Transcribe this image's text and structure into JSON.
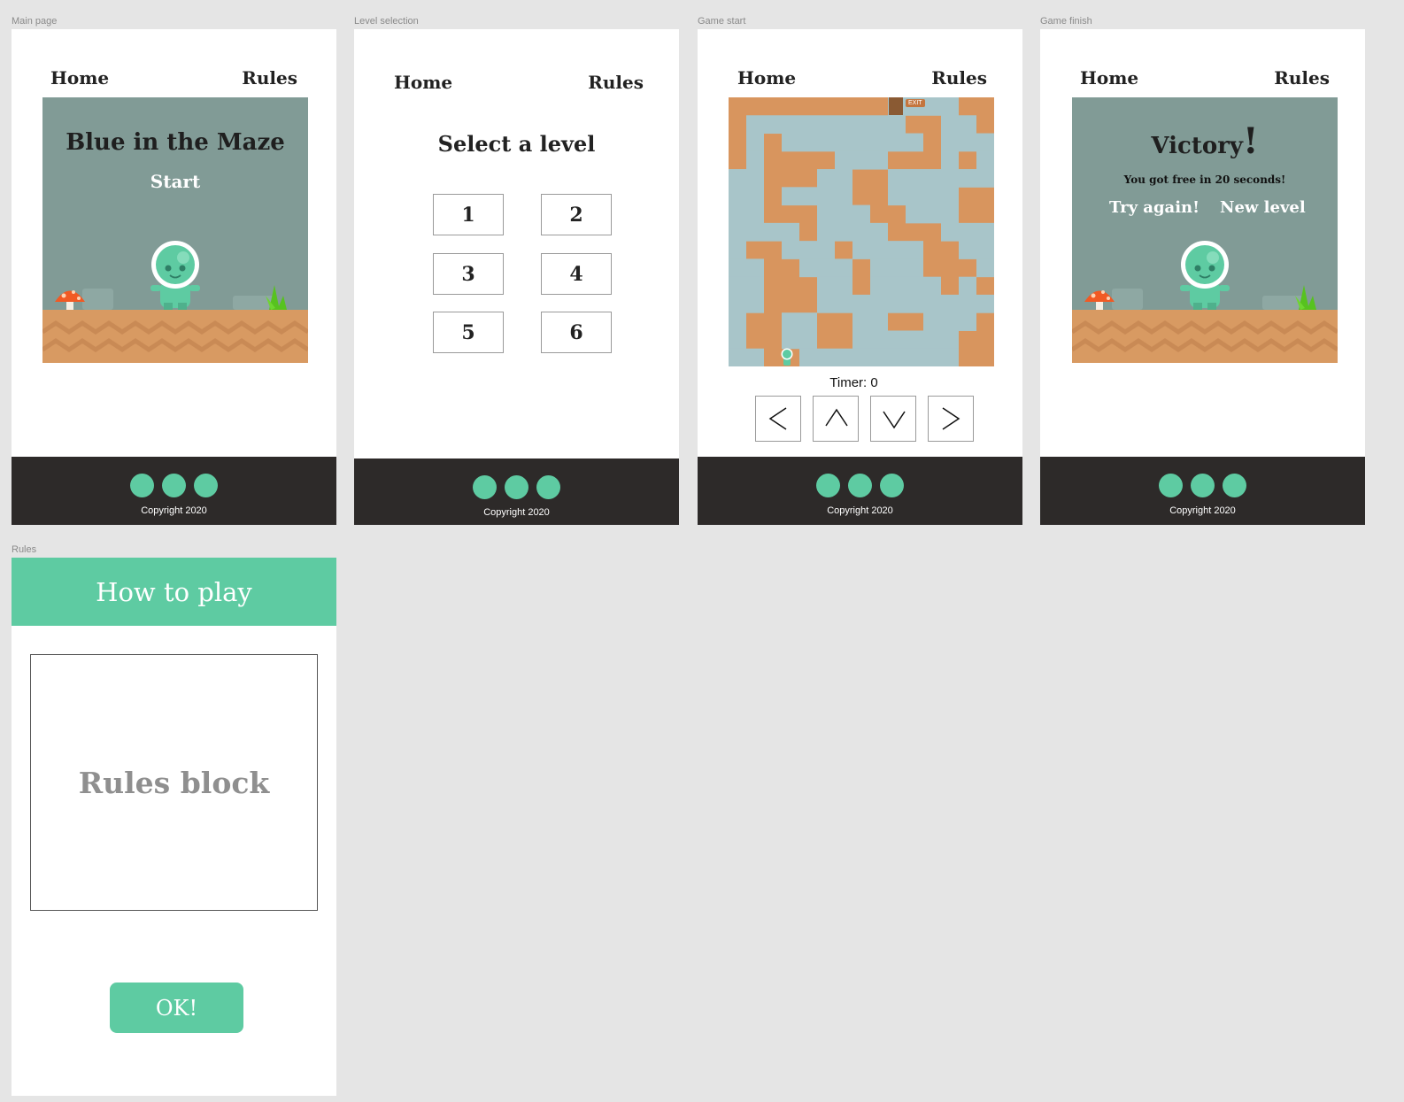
{
  "frames": {
    "main": {
      "label": "Main page",
      "nav": {
        "home": "Home",
        "rules": "Rules"
      },
      "title": "Blue in the Maze",
      "start": "Start"
    },
    "level": {
      "label": "Level selection",
      "nav": {
        "home": "Home",
        "rules": "Rules"
      },
      "title": "Select a level",
      "levels": [
        "1",
        "2",
        "3",
        "4",
        "5",
        "6"
      ]
    },
    "game": {
      "label": "Game start",
      "nav": {
        "home": "Home",
        "rules": "Rules"
      },
      "exit": "EXIT",
      "timer": "Timer: 0",
      "controls": [
        "left-arrow-icon",
        "up-arrow-icon",
        "down-arrow-icon",
        "right-arrow-icon"
      ]
    },
    "finish": {
      "label": "Game finish",
      "nav": {
        "home": "Home",
        "rules": "Rules"
      },
      "title": "Victory",
      "title_mark": "!",
      "message": "You got free in 20 seconds!",
      "try_again": "Try again!",
      "new_level": "New level"
    },
    "rules": {
      "label": "Rules",
      "header": "How to play",
      "block": "Rules block",
      "ok": "OK!"
    }
  },
  "footer": {
    "copyright": "Copyright 2020"
  },
  "colors": {
    "accent": "#5ecba2",
    "footer_bg": "#2d2a29",
    "scene_bg": "#819b96",
    "ground": "#d89a62",
    "maze_water": "#a8c5c9",
    "maze_wall": "#d8955e"
  }
}
